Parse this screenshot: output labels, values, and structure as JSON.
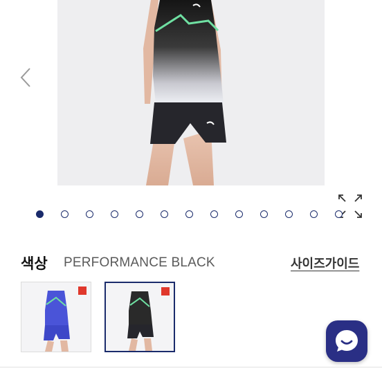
{
  "gallery": {
    "slide_count": 13,
    "active_index": 0,
    "prev_icon": "chevron-left-icon",
    "zoom_icon": "expand-arrows-icon"
  },
  "color": {
    "label": "색상",
    "selected_value": "PERFORMANCE BLACK",
    "size_guide_label": "사이즈가이드",
    "swatches": [
      {
        "name": "blue-variant",
        "selected": false,
        "accent": "#4a54d8"
      },
      {
        "name": "black-variant",
        "selected": true,
        "accent": "#1c1c1c"
      }
    ]
  },
  "chat": {
    "icon": "chat-bubble-icon",
    "color": "#2a2f85"
  },
  "colors": {
    "accent": "#1a2b6b",
    "badge": "#e0382c"
  }
}
